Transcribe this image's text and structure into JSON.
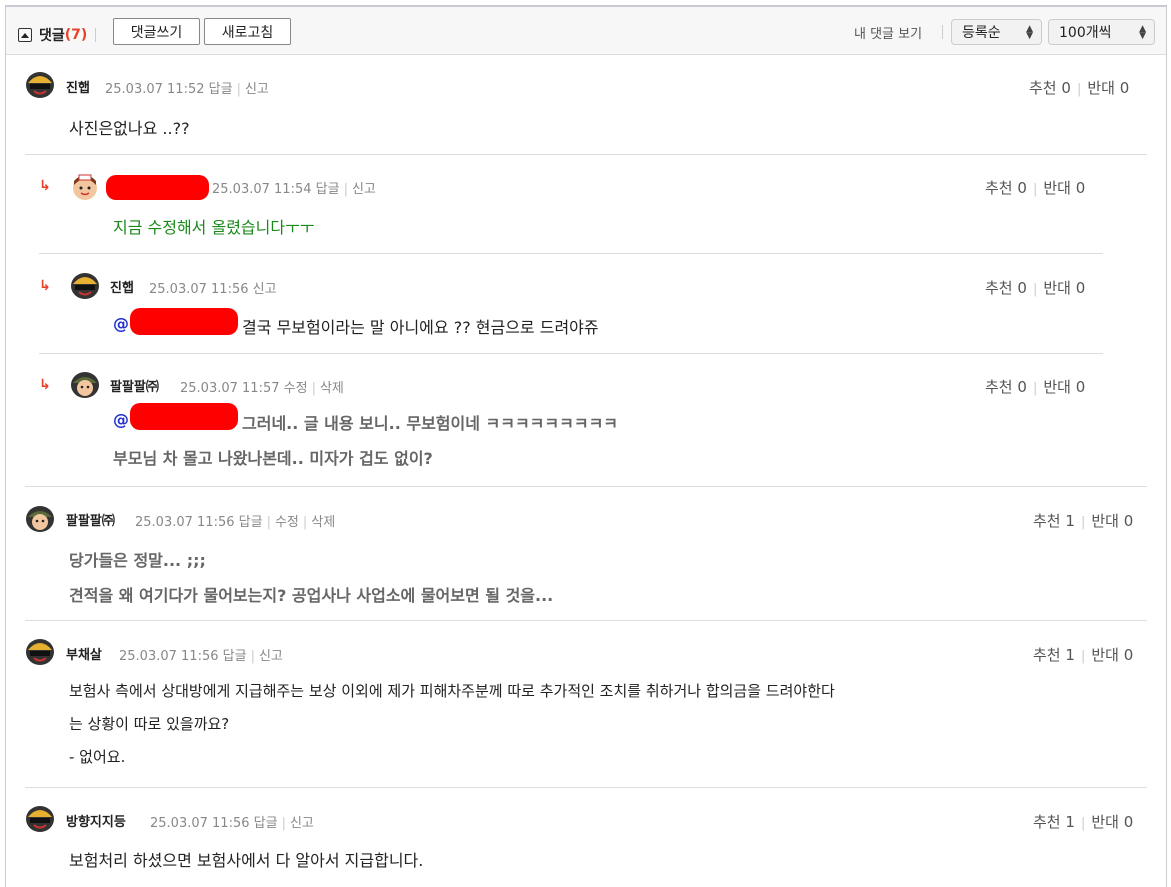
{
  "toolbar": {
    "title": "댓글",
    "count": "(7)",
    "write_label": "댓글쓰기",
    "refresh_label": "새로고침",
    "my_comments": "내 댓글 보기",
    "sort_value": "등록순",
    "per_page_value": "100개씩"
  },
  "labels": {
    "reply": "답글",
    "report": "신고",
    "edit": "수정",
    "delete": "삭제",
    "up": "추천",
    "down": "반대"
  },
  "comments": [
    {
      "nick": "진햅",
      "time": "25.03.07 11:52",
      "up": "0",
      "down": "0",
      "text": [
        "사진은없나요 ..??"
      ]
    },
    {
      "nick": "",
      "time": "25.03.07 11:54",
      "up": "0",
      "down": "0",
      "text": [
        "지금 수정해서 올렸습니다ㅜㅜ"
      ]
    },
    {
      "nick": "진햅",
      "time": "25.03.07 11:56",
      "up": "0",
      "down": "0",
      "mention": "@",
      "text": [
        "결국 무보험이라는 말 아니에요 ?? 현금으로 드려야쥬"
      ]
    },
    {
      "nick": "팔팔팔㈜",
      "time": "25.03.07 11:57",
      "up": "0",
      "down": "0",
      "mention": "@",
      "text": [
        "그러네.. 글 내용 보니.. 무보험이네 ㅋㅋㅋㅋㅋㅋㅋㅋㅋ",
        "부모님 차 몰고 나왔나본데.. 미자가 겁도 없이?"
      ]
    },
    {
      "nick": "팔팔팔㈜",
      "time": "25.03.07 11:56",
      "up": "1",
      "down": "0",
      "text": [
        "당가들은 정말... ;;;",
        "견적을 왜 여기다가 물어보는지? 공업사나 사업소에 물어보면 될 것을..."
      ]
    },
    {
      "nick": "부채살",
      "time": "25.03.07 11:56",
      "up": "1",
      "down": "0",
      "text": [
        "보험사 측에서 상대방에게 지급해주는 보상 이외에 제가 피해차주분께 따로 추가적인 조치를 취하거나 합의금을 드려야한다",
        "는 상황이 따로 있을까요?",
        "- 없어요."
      ]
    },
    {
      "nick": "방향지지등",
      "time": "25.03.07 11:56",
      "up": "1",
      "down": "0",
      "text": [
        "보험처리 하셨으면 보험사에서 다 알아서 지급합니다."
      ]
    }
  ]
}
